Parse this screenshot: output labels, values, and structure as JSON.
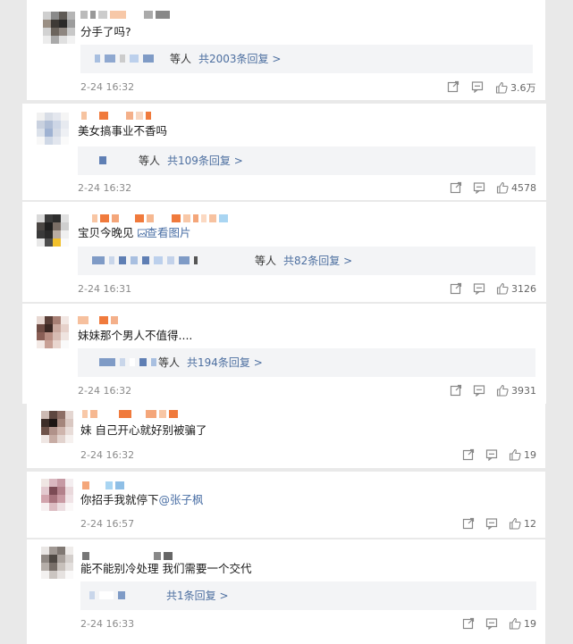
{
  "comments": [
    {
      "text": "分手了吗?",
      "reply_who": "等人",
      "reply_count": "共2003条回复 >",
      "time": "2-24 16:32",
      "likes": "3.6万"
    },
    {
      "text": "美女搞事业不香吗",
      "reply_who": "等人",
      "reply_count": "共109条回复 >",
      "time": "2-24 16:32",
      "likes": "4578"
    },
    {
      "text": "宝贝今晚见",
      "link": "查看图片",
      "reply_who": "等人",
      "reply_count": "共82条回复 >",
      "time": "2-24 16:31",
      "likes": "3126"
    },
    {
      "text": "妹妹那个男人不值得....",
      "reply_who": "等人",
      "reply_count": "共194条回复 >",
      "time": "2-24 16:32",
      "likes": "3931"
    },
    {
      "text": "妹 自己开心就好别被骗了",
      "time": "2-24 16:32",
      "likes": "19"
    },
    {
      "text": "你招手我就停下",
      "link": "@张子枫",
      "time": "2-24 16:57",
      "likes": "12"
    },
    {
      "text": "能不能别冷处理 我们需要一个交代",
      "reply_count": "共1条回复 >",
      "time": "2-24 16:33",
      "likes": "19"
    }
  ],
  "colors": {
    "link_blue": "#4d6fa0",
    "mosaic_orange": "#f07a3c",
    "mosaic_blue": "#7f9bc6"
  },
  "icons": [
    "share-icon",
    "comment-icon",
    "like-icon",
    "image-icon"
  ]
}
